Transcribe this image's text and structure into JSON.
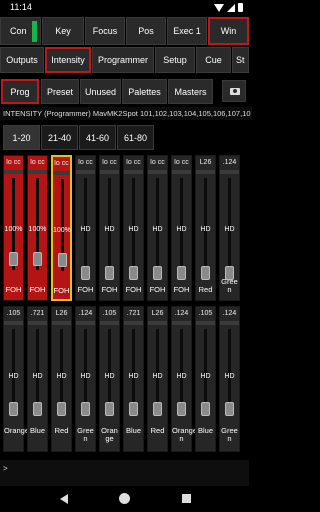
{
  "status": {
    "time": "11:14"
  },
  "toolbar1": {
    "items": [
      "Con",
      "Key",
      "Focus",
      "Pos",
      "Exec 1",
      "Win"
    ],
    "selected": "Win"
  },
  "toolbar2": {
    "items": [
      "Outputs",
      "Intensity",
      "Programmer",
      "Setup",
      "Cue",
      "St"
    ],
    "selected": "Intensity"
  },
  "toolbar3": {
    "items": [
      "Prog",
      "Preset",
      "Unused",
      "Palettes",
      "Masters"
    ],
    "selected": "Prog"
  },
  "command_line": "INTENSITY (Programmer) MavMK2Spot 101,102,103,104,105,106,107,10",
  "range_tabs": {
    "items": [
      "1-20",
      "21-40",
      "41-60",
      "61-80"
    ],
    "selected": "1-20"
  },
  "faders_top": [
    {
      "label": "lo cc",
      "value": "100%",
      "group": "FOH",
      "group2": "",
      "active": true,
      "highlight": false
    },
    {
      "label": "lo cc",
      "value": "100%",
      "group": "FOH",
      "group2": "",
      "active": true,
      "highlight": false
    },
    {
      "label": "lo cc",
      "value": "100%",
      "group": "FOH",
      "group2": "",
      "active": true,
      "highlight": true
    },
    {
      "label": "lo cc",
      "value": "HD",
      "group": "FOH",
      "group2": "",
      "active": false,
      "highlight": false
    },
    {
      "label": "lo cc",
      "value": "HD",
      "group": "FOH",
      "group2": "",
      "active": false,
      "highlight": false
    },
    {
      "label": "lo cc",
      "value": "HD",
      "group": "FOH",
      "group2": "",
      "active": false,
      "highlight": false
    },
    {
      "label": "lo cc",
      "value": "HD",
      "group": "FOH",
      "group2": "",
      "active": false,
      "highlight": false
    },
    {
      "label": "lo cc",
      "value": "HD",
      "group": "FOH",
      "group2": "",
      "active": false,
      "highlight": false
    },
    {
      "label": "L26",
      "value": "HD",
      "group": "Red",
      "group2": "",
      "active": false,
      "highlight": false
    },
    {
      "label": ".124",
      "value": "HD",
      "group": "Gree",
      "group2": "n",
      "active": false,
      "highlight": false
    }
  ],
  "faders_bottom": [
    {
      "label": ".105",
      "value": "HD",
      "group": "Orange",
      "group2": ""
    },
    {
      "label": ".721",
      "value": "HD",
      "group": "Blue",
      "group2": ""
    },
    {
      "label": "L26",
      "value": "HD",
      "group": "Red",
      "group2": ""
    },
    {
      "label": ".124",
      "value": "HD",
      "group": "Gree",
      "group2": "n"
    },
    {
      "label": ".105",
      "value": "HD",
      "group": "Oran",
      "group2": "ge"
    },
    {
      "label": ".721",
      "value": "HD",
      "group": "Blue",
      "group2": ""
    },
    {
      "label": "L26",
      "value": "HD",
      "group": "Red",
      "group2": ""
    },
    {
      "label": ".124",
      "value": "HD",
      "group": "Orange",
      "group2": "n"
    },
    {
      "label": ".105",
      "value": "HD",
      "group": "Blue",
      "group2": ""
    },
    {
      "label": ".124",
      "value": "HD",
      "group": "Gree",
      "group2": "n"
    }
  ],
  "command_prompt": ">",
  "colors": {
    "accent_red": "#c01818",
    "active_fader": "#b41414",
    "highlight": "#e1c21b",
    "con_indicator": "#18b34a"
  },
  "icons": {
    "camera": "camera-icon",
    "back": "back-icon",
    "home": "home-icon",
    "recent": "recent-apps-icon"
  }
}
